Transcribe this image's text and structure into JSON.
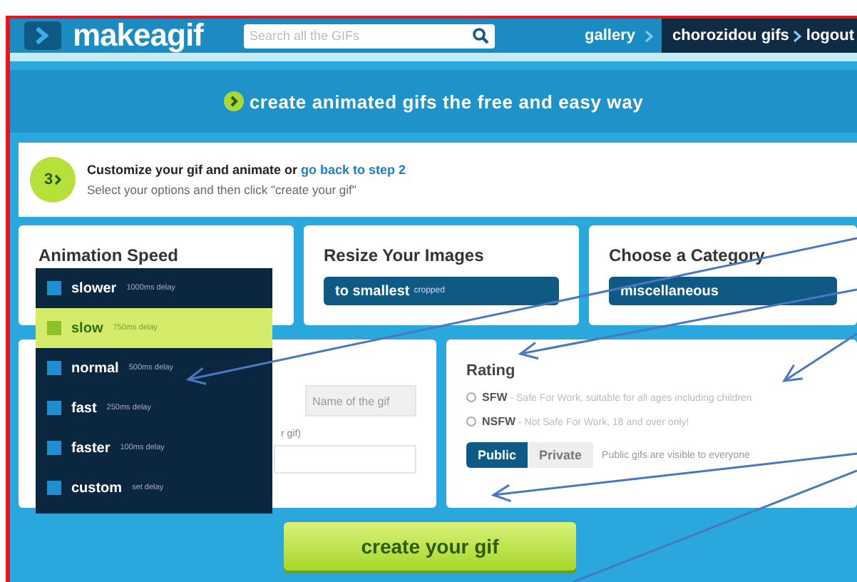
{
  "header": {
    "logo": "makeagif",
    "search": {
      "placeholder": "Search all the GIFs"
    },
    "nav": [
      {
        "label": "gallery",
        "kind": "plain"
      },
      {
        "label": "chorozidou gifs",
        "kind": "dark"
      },
      {
        "label": "logout",
        "kind": "dark"
      }
    ]
  },
  "banner": {
    "text": "create animated gifs the free and easy way"
  },
  "step": {
    "number": "3",
    "title": "Customize your gif and animate or ",
    "link": "go back to step 2",
    "subtitle": "Select your options and then click \"create your gif\""
  },
  "speed": {
    "title": "Animation Speed",
    "options": [
      {
        "label": "slower",
        "detail": "1000ms delay",
        "selected": false
      },
      {
        "label": "slow",
        "detail": "750ms delay",
        "selected": true
      },
      {
        "label": "normal",
        "detail": "500ms delay",
        "selected": false
      },
      {
        "label": "fast",
        "detail": "250ms delay",
        "selected": false
      },
      {
        "label": "faster",
        "detail": "100ms delay",
        "selected": false
      },
      {
        "label": "custom",
        "detail": "set delay",
        "selected": false
      }
    ]
  },
  "resize": {
    "title": "Resize Your Images",
    "value": "to smallest",
    "note": "cropped"
  },
  "category": {
    "title": "Choose a Category",
    "value": "miscellaneous"
  },
  "name": {
    "placeholder": "Name of the gif",
    "note": "r gif)"
  },
  "rating": {
    "title": "Rating",
    "options": [
      {
        "label": "SFW",
        "description": "- Safe For Work, suitable for all ages including children",
        "selected": false
      },
      {
        "label": "NSFW",
        "description": "- Not Safe For Work, 18 and over only!",
        "selected": false
      }
    ],
    "visibility": [
      {
        "label": "Public",
        "selected": true
      },
      {
        "label": "Private",
        "selected": false
      }
    ],
    "note": "Public gifs are visible to everyone"
  },
  "button": {
    "label": "create your gif"
  }
}
